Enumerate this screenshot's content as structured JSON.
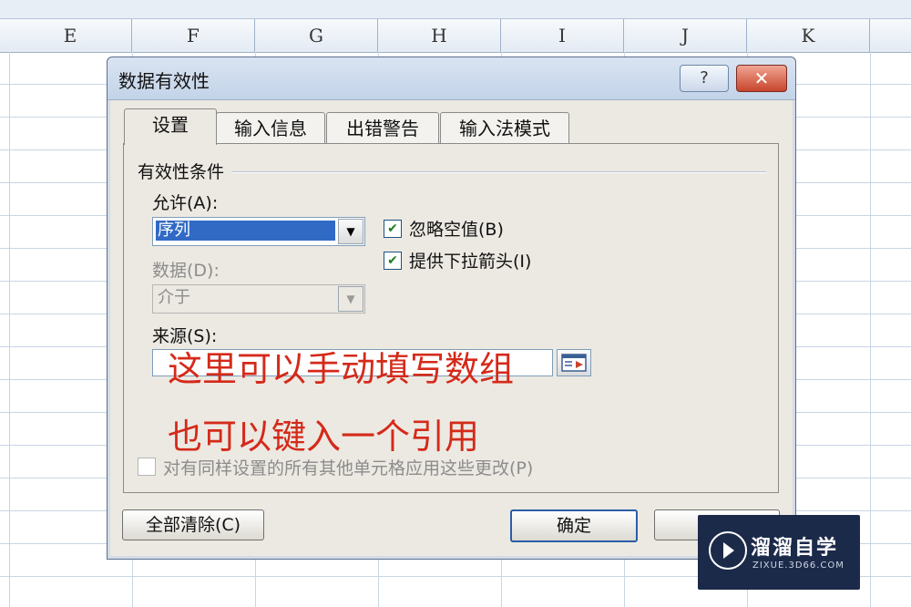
{
  "sheet": {
    "columns": [
      "E",
      "F",
      "G",
      "H",
      "I",
      "J",
      "K"
    ]
  },
  "dialog": {
    "title": "数据有效性",
    "help_label": "?",
    "close_label": "✕",
    "tabs": [
      {
        "label": "设置",
        "active": true
      },
      {
        "label": "输入信息",
        "active": false
      },
      {
        "label": "出错警告",
        "active": false
      },
      {
        "label": "输入法模式",
        "active": false
      }
    ],
    "settings": {
      "group_label": "有效性条件",
      "allow_label": "允许(A):",
      "allow_value": "序列",
      "data_label": "数据(D):",
      "data_value": "介于",
      "source_label": "来源(S):",
      "source_value": "",
      "ignore_blank_label": "忽略空值(B)",
      "ignore_blank_checked": true,
      "dropdown_label": "提供下拉箭头(I)",
      "dropdown_checked": true,
      "apply_all_label": "对有同样设置的所有其他单元格应用这些更改(P)",
      "apply_all_checked": false
    },
    "buttons": {
      "clear_all": "全部清除(C)",
      "ok": "确定"
    }
  },
  "annotations": {
    "line1": "这里可以手动填写数组",
    "line2": "也可以键入一个引用"
  },
  "watermark": {
    "name": "溜溜自学",
    "url": "ZIXUE.3D66.COM"
  },
  "colors": {
    "annotation": "#d42a1a",
    "selection": "#316ac5",
    "close_button": "#c8452c"
  }
}
